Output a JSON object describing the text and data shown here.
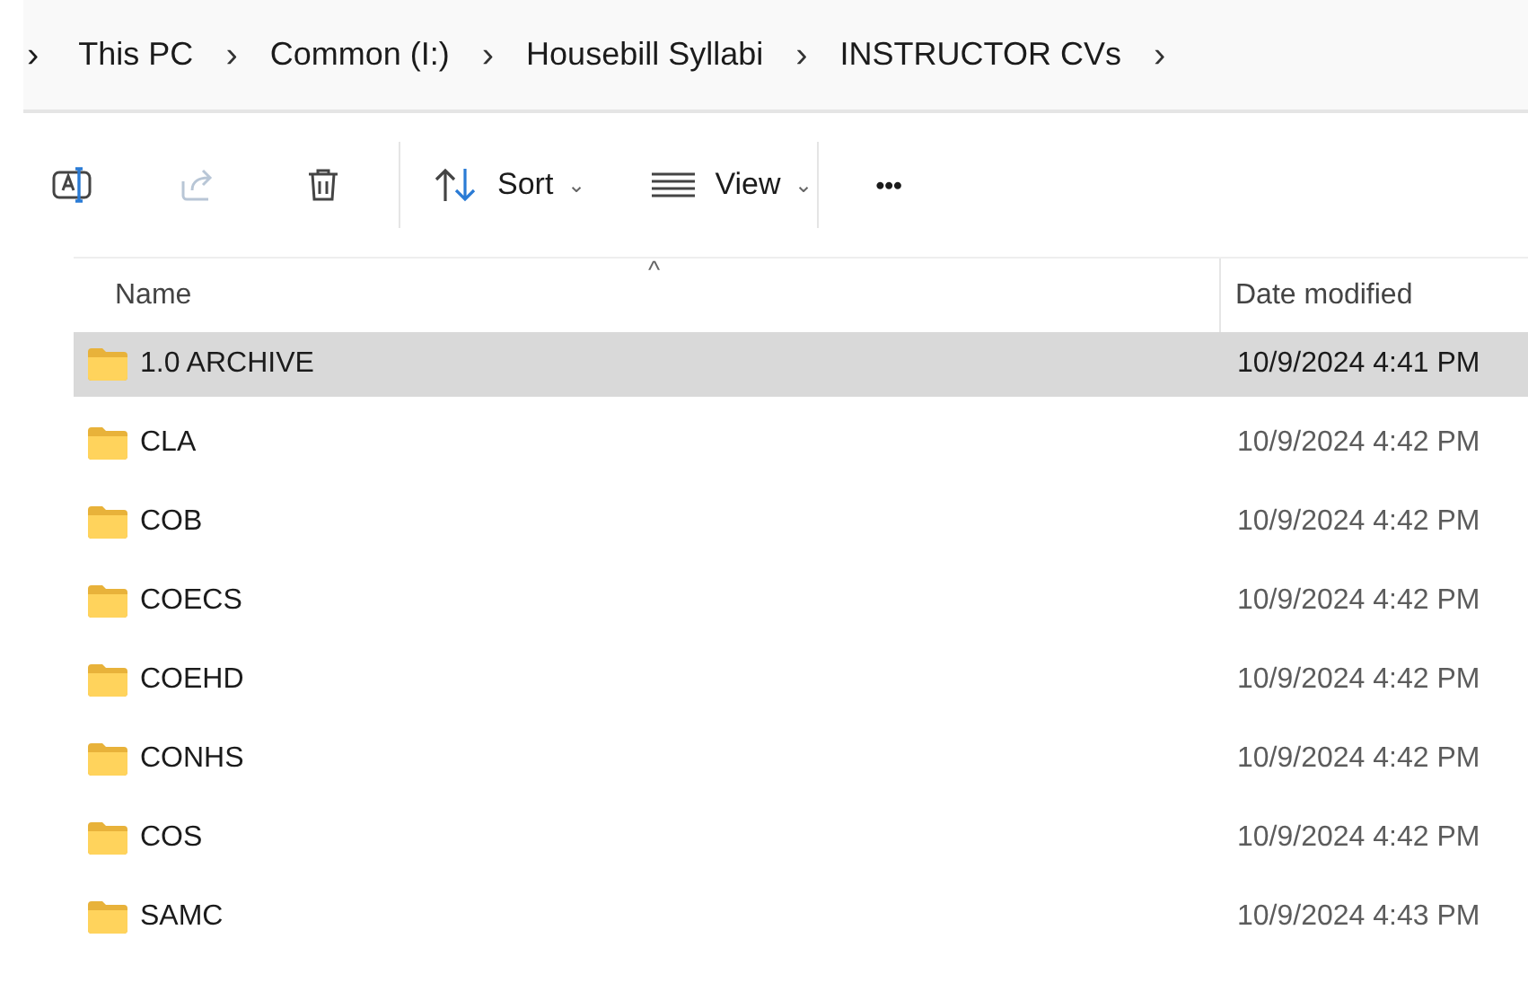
{
  "breadcrumb": {
    "leading": "›",
    "items": [
      {
        "label": "This PC",
        "separator": "›"
      },
      {
        "label": "Common (I:)",
        "separator": "›"
      },
      {
        "label": "Housebill Syllabi",
        "separator": "›"
      },
      {
        "label": "INSTRUCTOR CVs",
        "separator": "›"
      }
    ]
  },
  "toolbar": {
    "tools": [
      {
        "kind": "rename",
        "disabled": false
      },
      {
        "kind": "share",
        "disabled": true
      },
      {
        "kind": "delete",
        "disabled": false
      }
    ],
    "sort": {
      "label": "Sort",
      "caret": "⌄"
    },
    "view": {
      "label": "View",
      "caret": "⌄"
    },
    "more": "•••"
  },
  "table": {
    "columns": [
      {
        "label": "Name",
        "sort_indicator": "^"
      },
      {
        "label": "Date modified"
      }
    ],
    "rows": [
      {
        "name": "1.0 ARCHIVE",
        "date": "10/9/2024 4:41 PM",
        "selected": true
      },
      {
        "name": "CLA",
        "date": "10/9/2024 4:42 PM",
        "selected": false
      },
      {
        "name": "COB",
        "date": "10/9/2024 4:42 PM",
        "selected": false
      },
      {
        "name": "COECS",
        "date": "10/9/2024 4:42 PM",
        "selected": false
      },
      {
        "name": "COEHD",
        "date": "10/9/2024 4:42 PM",
        "selected": false
      },
      {
        "name": "CONHS",
        "date": "10/9/2024 4:42 PM",
        "selected": false
      },
      {
        "name": "COS",
        "date": "10/9/2024 4:42 PM",
        "selected": false
      },
      {
        "name": "SAMC",
        "date": "10/9/2024 4:43 PM",
        "selected": false
      }
    ]
  }
}
